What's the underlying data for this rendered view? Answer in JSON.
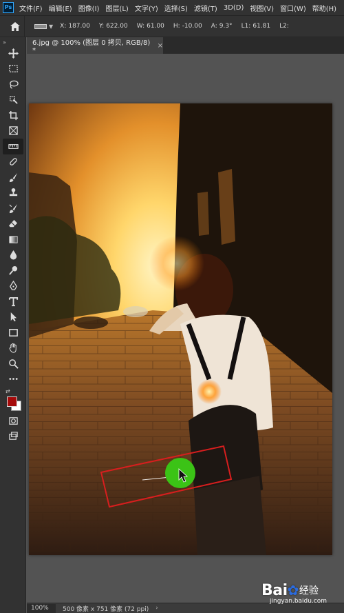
{
  "app": {
    "logo_text": "Ps"
  },
  "menu": [
    "文件(F)",
    "编辑(E)",
    "图像(I)",
    "图层(L)",
    "文字(Y)",
    "选择(S)",
    "滤镜(T)",
    "3D(D)",
    "视图(V)",
    "窗口(W)",
    "帮助(H)"
  ],
  "options_bar": {
    "x": {
      "label": "X:",
      "value": "187.00"
    },
    "y": {
      "label": "Y:",
      "value": "622.00"
    },
    "w": {
      "label": "W:",
      "value": "61.00"
    },
    "h": {
      "label": "H:",
      "value": "-10.00"
    },
    "a": {
      "label": "A:",
      "value": "9.3°"
    },
    "l1": {
      "label": "L1:",
      "value": "61.81"
    },
    "l2": {
      "label": "L2:",
      "value": ""
    }
  },
  "document_tab": {
    "title": "6.jpg @ 100% (图层 0 拷贝, RGB/8) *",
    "close": "×"
  },
  "status_bar": {
    "zoom": "100%",
    "info": "500 像素 x 751 像素 (72 ppi)",
    "more": "›"
  },
  "colors": {
    "foreground": "#a50a0a",
    "background": "#ffffff",
    "highlight_box": "#d81e1e",
    "click_indicator": "#3bc316"
  },
  "watermark": {
    "logo": "Bai du",
    "paw": "🐾",
    "suffix": "经验",
    "url": "jingyan.baidu.com"
  },
  "tools": [
    "move-icon",
    "marquee-icon",
    "lasso-icon",
    "quick-select-icon",
    "crop-icon",
    "frame-icon",
    "ruler-icon",
    "healing-icon",
    "brush-icon",
    "stamp-icon",
    "history-brush-icon",
    "eraser-icon",
    "gradient-icon",
    "blur-icon",
    "dodge-icon",
    "pen-icon",
    "type-icon",
    "path-select-icon",
    "shape-icon",
    "hand-icon",
    "zoom-icon",
    "more-tools-icon"
  ]
}
